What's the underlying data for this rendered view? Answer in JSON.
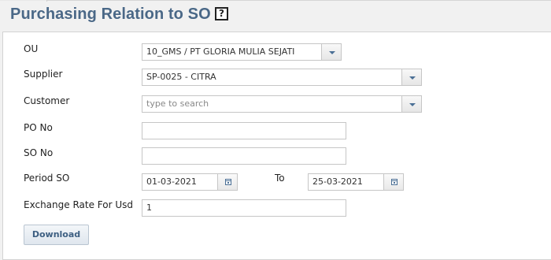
{
  "page": {
    "title": "Purchasing Relation to SO",
    "help_icon_glyph": "?"
  },
  "form": {
    "ou": {
      "label": "OU",
      "value": "10_GMS / PT GLORIA MULIA SEJATI",
      "icon": "chevron-down-icon"
    },
    "supplier": {
      "label": "Supplier",
      "value": "SP-0025 - CITRA",
      "icon": "chevron-down-icon"
    },
    "customer": {
      "label": "Customer",
      "placeholder": "type to search",
      "icon": "chevron-down-icon"
    },
    "po_no": {
      "label": "PO No",
      "value": ""
    },
    "so_no": {
      "label": "SO No",
      "value": ""
    },
    "period_so": {
      "label": "Period SO",
      "from": "01-03-2021",
      "to_label": "To",
      "to": "25-03-2021",
      "icon": "calendar-icon"
    },
    "exchange_rate": {
      "label": "Exchange Rate For Usd",
      "value": "1"
    }
  },
  "actions": {
    "download_label": "Download"
  },
  "colors": {
    "title": "#4a6887",
    "accent": "#4a6f95",
    "button_text": "#3d5f82"
  }
}
